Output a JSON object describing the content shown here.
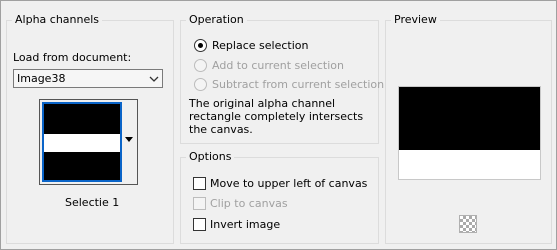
{
  "alpha": {
    "title": "Alpha channels",
    "load_label": "Load from document:",
    "document_value": "Image38",
    "channel_name": "Selectie 1"
  },
  "operation": {
    "title": "Operation",
    "options": [
      {
        "label": "Replace selection",
        "selected": true,
        "enabled": true
      },
      {
        "label": "Add to current selection",
        "selected": false,
        "enabled": false
      },
      {
        "label": "Subtract from current selection",
        "selected": false,
        "enabled": false
      }
    ],
    "description": "The original alpha channel rectangle completely intersects the canvas."
  },
  "options": {
    "title": "Options",
    "items": [
      {
        "label": "Move to upper left of canvas",
        "checked": false,
        "enabled": true
      },
      {
        "label": "Clip to canvas",
        "checked": false,
        "enabled": false
      },
      {
        "label": "Invert image",
        "checked": false,
        "enabled": true
      }
    ]
  },
  "preview": {
    "title": "Preview"
  },
  "colors": {
    "selection_border": "#0a64c8"
  }
}
